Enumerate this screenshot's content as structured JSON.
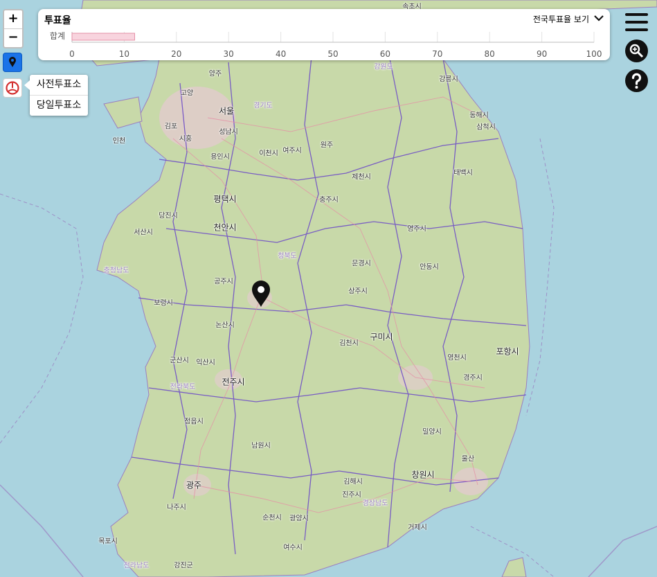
{
  "panel": {
    "title": "투표율",
    "link_label": "전국투표율 보기",
    "row_label": "합계",
    "turnout_percent": 12,
    "axis_ticks": [
      "0",
      "10",
      "20",
      "30",
      "40",
      "50",
      "60",
      "70",
      "80",
      "90",
      "100"
    ]
  },
  "popup": {
    "early_label": "사전투표소",
    "day_label": "당일투표소"
  },
  "zoom": {
    "in_label": "+",
    "out_label": "−"
  },
  "colors": {
    "sea": "#aad3df",
    "land": "#c8d9a9",
    "bar_fill": "#f8d4de",
    "bar_stroke": "#e58fa6",
    "boundary": "#6b48c8",
    "locate_button": "#1a73e8",
    "vote_icon": "#d32f2f"
  },
  "icons": {
    "locate": "map-pin-icon",
    "vote": "vote-stamp-icon",
    "menu": "hamburger-menu-icon",
    "search": "search-zoom-icon",
    "help": "help-question-icon",
    "chevron": "chevron-down-icon",
    "marker": "map-marker-icon"
  },
  "map_labels": [
    {
      "text": "속초시",
      "cls": ""
    },
    {
      "text": "인천",
      "cls": ""
    },
    {
      "text": "양주",
      "cls": ""
    },
    {
      "text": "고양",
      "cls": ""
    },
    {
      "text": "경기도",
      "cls": "prov"
    },
    {
      "text": "김포",
      "cls": ""
    },
    {
      "text": "서울",
      "cls": "big"
    },
    {
      "text": "성남시",
      "cls": ""
    },
    {
      "text": "시흥",
      "cls": ""
    },
    {
      "text": "용인시",
      "cls": ""
    },
    {
      "text": "이천시",
      "cls": ""
    },
    {
      "text": "여주시",
      "cls": ""
    },
    {
      "text": "원주",
      "cls": ""
    },
    {
      "text": "강원도",
      "cls": "prov"
    },
    {
      "text": "강릉시",
      "cls": ""
    },
    {
      "text": "동해시",
      "cls": ""
    },
    {
      "text": "삼척시",
      "cls": ""
    },
    {
      "text": "태백시",
      "cls": ""
    },
    {
      "text": "제천시",
      "cls": ""
    },
    {
      "text": "충주시",
      "cls": ""
    },
    {
      "text": "평택시",
      "cls": "big"
    },
    {
      "text": "당진시",
      "cls": ""
    },
    {
      "text": "서산시",
      "cls": ""
    },
    {
      "text": "천안시",
      "cls": "big"
    },
    {
      "text": "충청남도",
      "cls": "prov"
    },
    {
      "text": "청북도",
      "cls": "prov"
    },
    {
      "text": "영주시",
      "cls": ""
    },
    {
      "text": "문경시",
      "cls": ""
    },
    {
      "text": "안동시",
      "cls": ""
    },
    {
      "text": "공주시",
      "cls": ""
    },
    {
      "text": "보령시",
      "cls": ""
    },
    {
      "text": "상주시",
      "cls": ""
    },
    {
      "text": "논산시",
      "cls": ""
    },
    {
      "text": "김천시",
      "cls": ""
    },
    {
      "text": "구미시",
      "cls": "big"
    },
    {
      "text": "포항시",
      "cls": "big"
    },
    {
      "text": "군산시",
      "cls": ""
    },
    {
      "text": "익산시",
      "cls": ""
    },
    {
      "text": "영천시",
      "cls": ""
    },
    {
      "text": "경주시",
      "cls": ""
    },
    {
      "text": "전라북도",
      "cls": "prov"
    },
    {
      "text": "전주시",
      "cls": "big"
    },
    {
      "text": "정읍시",
      "cls": ""
    },
    {
      "text": "밀양시",
      "cls": ""
    },
    {
      "text": "울산",
      "cls": ""
    },
    {
      "text": "남원시",
      "cls": ""
    },
    {
      "text": "김해시",
      "cls": ""
    },
    {
      "text": "창원시",
      "cls": "big"
    },
    {
      "text": "진주시",
      "cls": ""
    },
    {
      "text": "광주",
      "cls": "big"
    },
    {
      "text": "경상남도",
      "cls": "prov"
    },
    {
      "text": "나주시",
      "cls": ""
    },
    {
      "text": "순천시",
      "cls": ""
    },
    {
      "text": "광양시",
      "cls": ""
    },
    {
      "text": "거제시",
      "cls": ""
    },
    {
      "text": "목포시",
      "cls": ""
    },
    {
      "text": "여수시",
      "cls": ""
    },
    {
      "text": "전라남도",
      "cls": "prov"
    },
    {
      "text": "강진군",
      "cls": ""
    }
  ]
}
